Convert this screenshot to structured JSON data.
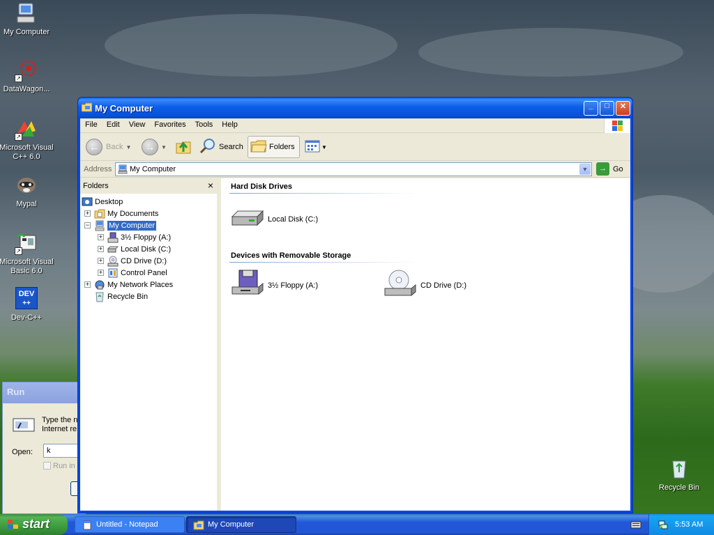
{
  "desktop": {
    "icons": [
      {
        "label_line1": "My Computer",
        "label_line2": ""
      },
      {
        "label_line1": "DataWagon...",
        "label_line2": ""
      },
      {
        "label_line1": "Microsoft Visual",
        "label_line2": "C++ 6.0"
      },
      {
        "label_line1": "Mypal",
        "label_line2": ""
      },
      {
        "label_line1": "Microsoft Visual",
        "label_line2": "Basic 6.0"
      },
      {
        "label_line1": "Dev-C++",
        "label_line2": ""
      },
      {
        "label_line1": "Recycle Bin",
        "label_line2": ""
      }
    ],
    "devcpp_badge": "DEV"
  },
  "run_dialog": {
    "title": "Run",
    "text_line1": "Type the n",
    "text_line2": "Internet re",
    "open_label": "Open:",
    "open_value": "k",
    "checkbox_label": "Run in s"
  },
  "window": {
    "title": "My Computer",
    "menu": [
      "File",
      "Edit",
      "View",
      "Favorites",
      "Tools",
      "Help"
    ],
    "toolbar": {
      "back": "Back",
      "search": "Search",
      "folders": "Folders"
    },
    "address": {
      "label": "Address",
      "value": "My Computer",
      "go": "Go"
    },
    "folders_pane": {
      "header": "Folders",
      "close": "×",
      "tree": [
        {
          "label": "Desktop",
          "pm": ""
        },
        {
          "label": "My Documents",
          "pm": "+"
        },
        {
          "label": "My Computer",
          "pm": "−"
        },
        {
          "label": "3½ Floppy (A:)",
          "pm": "+"
        },
        {
          "label": "Local Disk (C:)",
          "pm": "+"
        },
        {
          "label": "CD Drive (D:)",
          "pm": "+"
        },
        {
          "label": "Control Panel",
          "pm": "+"
        },
        {
          "label": "My Network Places",
          "pm": "+"
        },
        {
          "label": "Recycle Bin",
          "pm": ""
        }
      ]
    },
    "content": {
      "groups": [
        {
          "title": "Hard Disk Drives",
          "items": [
            "Local Disk (C:)"
          ]
        },
        {
          "title": "Devices with Removable Storage",
          "items": [
            "3½ Floppy (A:)",
            "CD Drive (D:)"
          ]
        }
      ]
    }
  },
  "taskbar": {
    "start": "start",
    "tasks": [
      "Untitled - Notepad",
      "My Computer"
    ],
    "clock": "5:53 AM"
  }
}
